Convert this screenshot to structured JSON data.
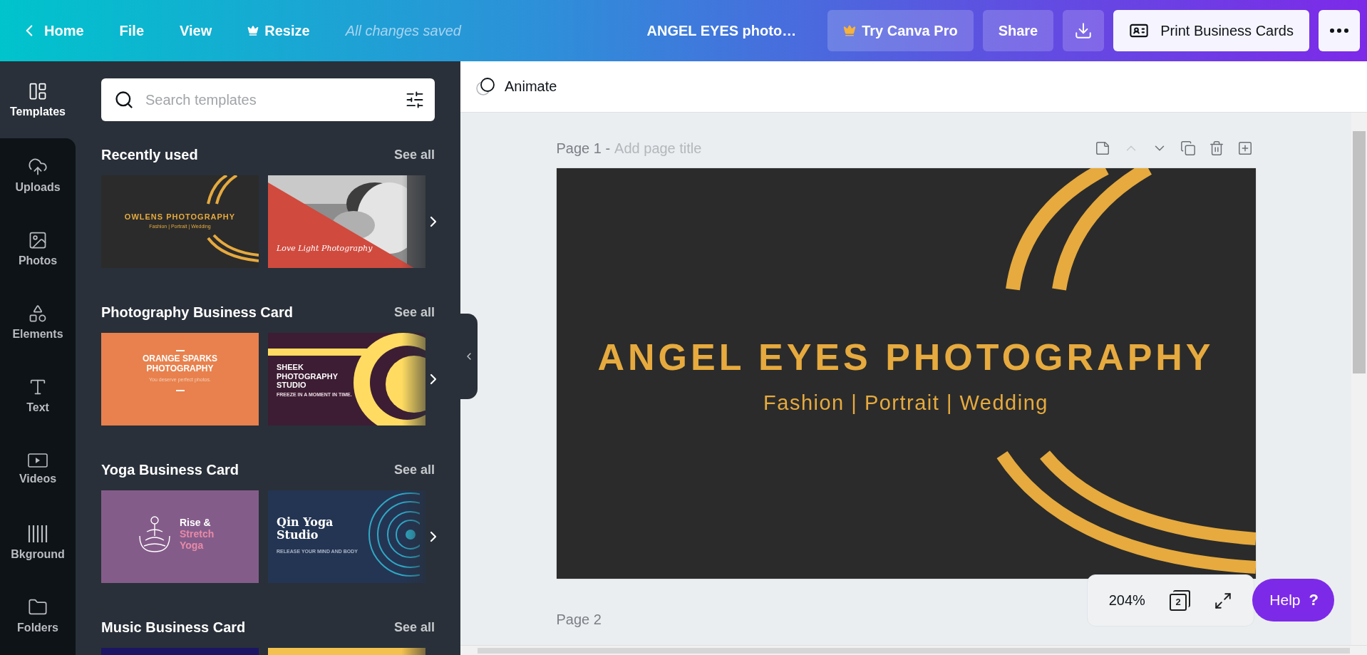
{
  "topbar": {
    "home": "Home",
    "menu_items": [
      "File",
      "View"
    ],
    "resize": "Resize",
    "save_status": "All changes saved",
    "document_title": "ANGEL EYES photo…",
    "pro_button": "Try Canva Pro",
    "share_button": "Share",
    "print_button": "Print Business Cards"
  },
  "rail": [
    {
      "label": "Templates",
      "selected": true
    },
    {
      "label": "Uploads",
      "selected": false
    },
    {
      "label": "Photos",
      "selected": false
    },
    {
      "label": "Elements",
      "selected": false
    },
    {
      "label": "Text",
      "selected": false
    },
    {
      "label": "Videos",
      "selected": false
    },
    {
      "label": "Bkground",
      "selected": false
    },
    {
      "label": "Folders",
      "selected": false
    }
  ],
  "search": {
    "placeholder": "Search templates"
  },
  "sections": [
    {
      "title": "Recently used",
      "link": "See all",
      "templates": [
        {
          "kind": "arcs",
          "texts": [
            {
              "text": "OWLENS PHOTOGRAPHY"
            },
            {
              "text": "Fashion | Portrait | Wedding"
            }
          ]
        },
        {
          "texts": [
            {
              "text": "Love Light Photography"
            }
          ]
        }
      ]
    },
    {
      "title": "Photography Business Card",
      "link": "See all",
      "templates": [
        {
          "kind": "orange",
          "texts": [
            {
              "text": "ORANGE SPARKS PHOTOGRAPHY"
            },
            {
              "text": "You deserve perfect photos."
            }
          ]
        },
        {
          "kind": "circle",
          "texts": [
            {
              "text": "SHEEK PHOTOGRAPHY STUDIO"
            },
            {
              "text": "FREEZE IN A MOMENT IN TIME."
            }
          ]
        }
      ]
    },
    {
      "title": "Yoga Business Card",
      "link": "See all",
      "templates": [
        {
          "kind": "meditation",
          "texts": [
            {
              "text": "Rise &",
              "color": "#ffffff"
            },
            {
              "text": "Stretch",
              "color": "#e68aa6"
            },
            {
              "text": "Yoga",
              "color": "#e68aa6"
            }
          ]
        },
        {
          "kind": "mandala",
          "texts": [
            {
              "text": "Qin Yoga Studio"
            },
            {
              "text": "RELEASE YOUR MIND AND BODY"
            }
          ]
        }
      ]
    },
    {
      "title": "Music Business Card",
      "link": "See all",
      "templates": [
        {
          "kind": "navy"
        },
        {
          "kind": "yellow"
        }
      ]
    }
  ],
  "toolbar": {
    "animate": "Animate"
  },
  "pages": [
    {
      "label": "Page 1 -",
      "title_placeholder": "Add page title",
      "design": {
        "title": "ANGEL EYES PHOTOGRAPHY",
        "subtitle": "Fashion | Portrait | Wedding"
      }
    },
    {
      "label": "Page 2"
    }
  ],
  "page_tools": [
    {
      "disabled": false
    },
    {
      "disabled": true
    },
    {
      "disabled": false
    },
    {
      "disabled": false
    },
    {
      "disabled": false
    },
    {
      "disabled": false
    }
  ],
  "zoom": {
    "value": "204%",
    "page_count": "2"
  },
  "help": {
    "label": "Help",
    "mark": "?"
  }
}
